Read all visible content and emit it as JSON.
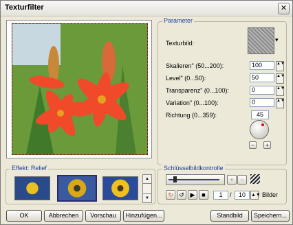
{
  "window": {
    "title": "Texturfilter",
    "close_glyph": "✕"
  },
  "parameter": {
    "group_label": "Parameter",
    "texture_label": "Texturbild:",
    "fields": [
      {
        "label": "Skalieren\" (50...200):",
        "value": "100"
      },
      {
        "label": "Level\" (0...50):",
        "value": "50"
      },
      {
        "label": "Transparenz\" (0...100):",
        "value": "0"
      },
      {
        "label": "Variation\" (0...100):",
        "value": "0"
      }
    ],
    "direction_label": "Richtung (0...359):",
    "direction_value": "45"
  },
  "effect": {
    "group_label": "Effekt: Relief"
  },
  "keyframe": {
    "group_label": "Schlüsselbildkontrolle",
    "frame_current": "1",
    "frame_sep": "/",
    "frame_total": "10",
    "frames_label": "Bilder"
  },
  "buttons": {
    "ok": "OK",
    "cancel": "Abbrechen",
    "preview": "Vorschau",
    "add": "Hinzufügen...",
    "still": "Standbild",
    "save": "Speichern..."
  },
  "icons": {
    "down_arrow": "▾",
    "minus": "−",
    "plus": "+",
    "spin": "▲▼",
    "scroll_up": "▲",
    "scroll_down": "▼",
    "play": "▶",
    "stop": "■",
    "loop": "↻",
    "wheel": "↺"
  },
  "colors": {
    "accent": "#1c3e9e",
    "dialog_bg": "#ece9d8"
  }
}
